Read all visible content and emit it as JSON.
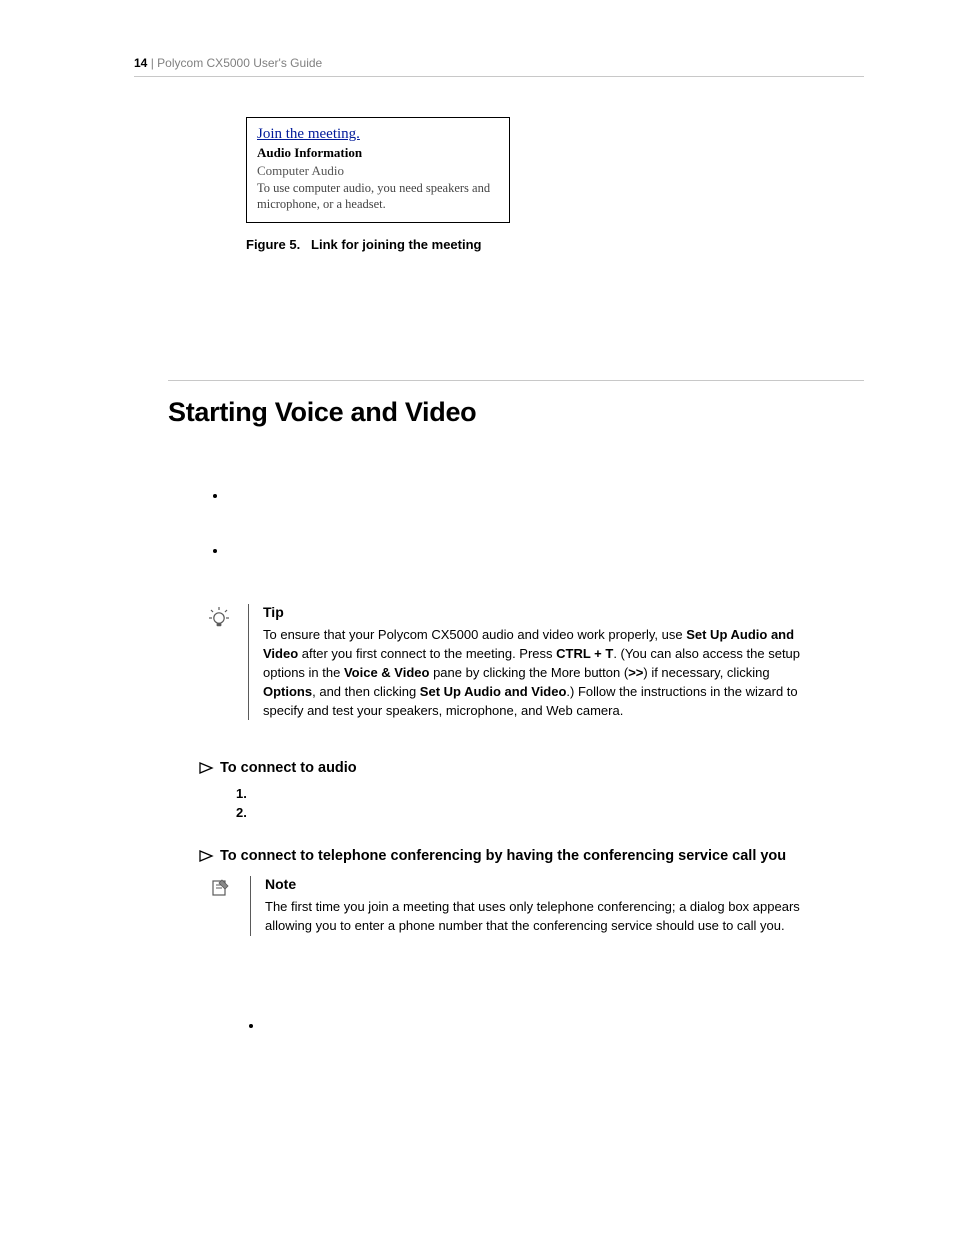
{
  "header": {
    "page_number": "14",
    "sep": "|",
    "doc_title": "Polycom CX5000 User's Guide"
  },
  "figure": {
    "link_text": "Join the meeting.",
    "audio_info_label": "Audio Information",
    "computer_audio_label": "Computer Audio",
    "body": "To use computer audio, you need speakers and microphone, or a headset.",
    "caption_prefix": "Figure 5.",
    "caption_text": "Link for joining the meeting"
  },
  "section": {
    "title": "Starting Voice and Video"
  },
  "tip": {
    "label": "Tip",
    "body_parts": {
      "p1": "To ensure that your Polycom CX5000 audio and video work properly, use ",
      "b1": "Set Up Audio and Video",
      "p2": " after you first connect to the meeting. Press ",
      "b2": "CTRL + T",
      "p3": ". (You can also access the setup options in the ",
      "b3": "Voice & Video",
      "p4": " pane by clicking the More button (",
      "b4": ">>",
      "p5": ") if necessary, clicking ",
      "b5": "Options",
      "p6": ", and then clicking ",
      "b6": "Set Up Audio and Video",
      "p7": ".) Follow the instructions in the wizard to specify and test your speakers, microphone, and Web camera."
    }
  },
  "proc_audio": {
    "title": "To connect to audio",
    "step1": "1.",
    "step2": "2."
  },
  "proc_tel": {
    "title": "To connect to telephone conferencing by having the conferencing service call you"
  },
  "note": {
    "label": "Note",
    "body": "The first time you join a meeting that uses only telephone conferencing; a dialog box appears allowing you to enter a phone number that the conferencing service should use to call you."
  }
}
